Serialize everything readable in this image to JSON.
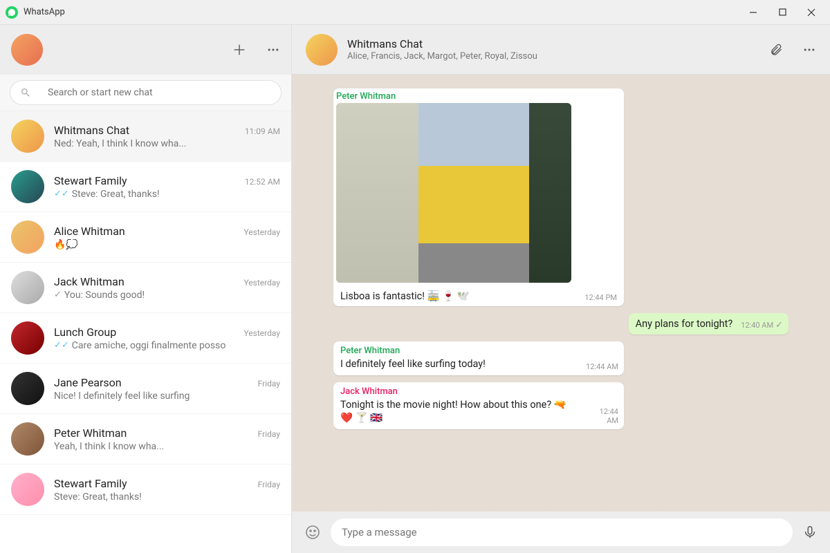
{
  "app": {
    "title": "WhatsApp"
  },
  "search": {
    "placeholder": "Search or start new chat"
  },
  "chats": [
    {
      "name": "Whitmans Chat",
      "time": "11:09 AM",
      "preview": "Ned: Yeah, I think I know wha...",
      "check": ""
    },
    {
      "name": "Stewart Family",
      "time": "12:52 AM",
      "preview": "Steve: Great, thanks!",
      "check": "read"
    },
    {
      "name": "Alice Whitman",
      "time": "Yesterday",
      "preview": "🔥💭",
      "check": ""
    },
    {
      "name": "Jack Whitman",
      "time": "Yesterday",
      "preview": "You: Sounds good!",
      "check": "sent"
    },
    {
      "name": "Lunch Group",
      "time": "Yesterday",
      "preview": "Care amiche, oggi finalmente posso",
      "check": "read"
    },
    {
      "name": "Jane Pearson",
      "time": "Friday",
      "preview": "Nice! I definitely feel like surfing",
      "check": ""
    },
    {
      "name": "Peter Whitman",
      "time": "Friday",
      "preview": "Yeah, I think I know wha...",
      "check": ""
    },
    {
      "name": "Stewart Family",
      "time": "Friday",
      "preview": "Steve: Great, thanks!",
      "check": ""
    }
  ],
  "conversation": {
    "title": "Whitmans Chat",
    "members": "Alice, Francis, Jack, Margot, Peter, Royal, Zissou"
  },
  "messages": [
    {
      "sender": "Peter Whitman",
      "sender_class": "green",
      "has_image": true,
      "text": "Lisboa is fantastic!  🚋 🍷 🕊️",
      "time": "12:44 PM",
      "out": false
    },
    {
      "sender": "",
      "text": "Any plans for tonight?",
      "time": "12:40 AM",
      "out": true,
      "check": "sent"
    },
    {
      "sender": "Peter Whitman",
      "sender_class": "green",
      "text": "I definitely feel like surfing today!",
      "time": "12:44 AM",
      "out": false
    },
    {
      "sender": "Jack Whitman",
      "sender_class": "pink",
      "text": "Tonight is the movie night! How about this one?  🔫 ❤️ 🍸 🇬🇧",
      "time": "12:44 AM",
      "out": false
    }
  ],
  "composer": {
    "placeholder": "Type a message"
  }
}
